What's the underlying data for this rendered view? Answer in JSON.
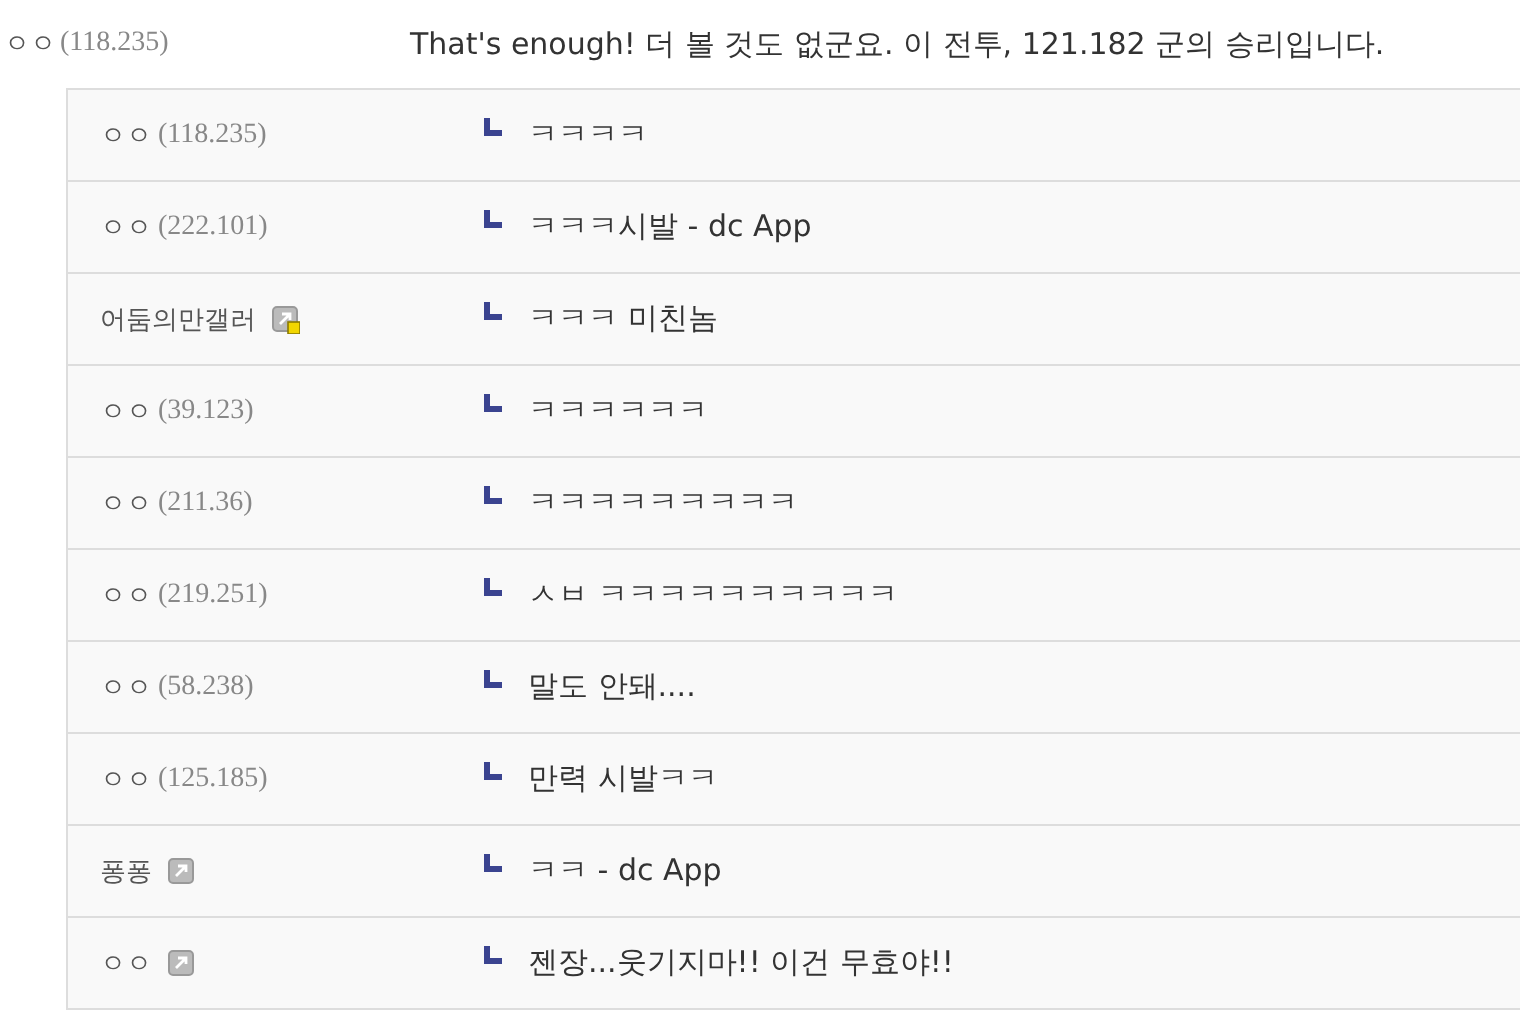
{
  "comment": {
    "name": "ㅇㅇ",
    "ip": "(118.235)",
    "text": "That's enough! 더 볼 것도 없군요. 이 전투, 121.182 군의 승리입니다."
  },
  "replies": [
    {
      "name": "ㅇㅇ",
      "ip": "(118.235)",
      "text": "ㅋㅋㅋㅋ"
    },
    {
      "name": "ㅇㅇ",
      "ip": "(222.101)",
      "text": "ㅋㅋㅋ시발 - dc App"
    },
    {
      "name": "어둠의만갤러",
      "member_icon": true,
      "half_fixed": true,
      "text": "ㅋㅋㅋ 미친놈"
    },
    {
      "name": "ㅇㅇ",
      "ip": "(39.123)",
      "text": "ㅋㅋㅋㅋㅋㅋ"
    },
    {
      "name": "ㅇㅇ",
      "ip": "(211.36)",
      "text": "ㅋㅋㅋㅋㅋㅋㅋㅋㅋ"
    },
    {
      "name": "ㅇㅇ",
      "ip": "(219.251)",
      "text": "ㅅㅂ ㅋㅋㅋㅋㅋㅋㅋㅋㅋㅋ"
    },
    {
      "name": "ㅇㅇ",
      "ip": "(58.238)",
      "text": "말도 안돼...."
    },
    {
      "name": "ㅇㅇ",
      "ip": "(125.185)",
      "text": "만력 시발ㅋㅋ"
    },
    {
      "name": "퐁퐁",
      "member_icon": true,
      "half_fixed": false,
      "text": "ㅋㅋ - dc App"
    },
    {
      "name": "ㅇㅇ",
      "member_icon": true,
      "half_fixed": false,
      "text": "젠장...웃기지마!! 이건 무효야!!"
    }
  ]
}
